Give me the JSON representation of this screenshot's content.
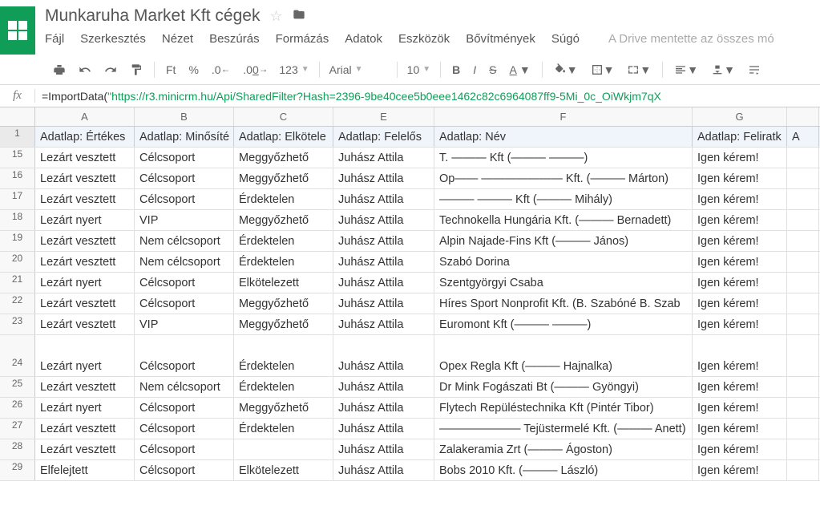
{
  "doc": {
    "title": "Munkaruha Market Kft cégek"
  },
  "menu": {
    "file": "Fájl",
    "edit": "Szerkesztés",
    "view": "Nézet",
    "insert": "Beszúrás",
    "format": "Formázás",
    "data": "Adatok",
    "tools": "Eszközök",
    "addons": "Bővítmények",
    "help": "Súgó",
    "drive_status": "A Drive mentette az összes mó"
  },
  "toolbar": {
    "currency": "Ft",
    "percent": "%",
    "dec_dec": ".0",
    "inc_dec": ".00",
    "num_format": "123",
    "font": "Arial",
    "size": "10"
  },
  "formula": {
    "prefix": "=ImportData(",
    "str": "\"https://r3.minicrm.hu/Api/SharedFilter?Hash=2396-9be40cee5b0eee1462c82c6964087ff9-5Mi_0c_OiWkjm7qX",
    "suffix": ""
  },
  "cols": {
    "A": "A",
    "B": "B",
    "C": "C",
    "D": "E",
    "E": "F",
    "G": "G"
  },
  "header": {
    "A": "Adatlap: Értékes",
    "B": "Adatlap: Minősíté",
    "C": "Adatlap: Elkötele",
    "D": "Adatlap: Felelős",
    "E": "Adatlap: Név",
    "G": "Adatlap: Feliratk",
    "H": "A"
  },
  "rows": [
    {
      "n": "15",
      "A": "Lezárt vesztett",
      "B": "Célcsoport",
      "C": "Meggyőzhető",
      "D": "Juhász Attila",
      "E": "T. ——— Kft (——— ———)",
      "G": "Igen kérem!"
    },
    {
      "n": "16",
      "A": "Lezárt vesztett",
      "B": "Célcsoport",
      "C": "Meggyőzhető",
      "D": "Juhász Attila",
      "E": "Op—— ——————— Kft. (——— Márton)",
      "G": "Igen kérem!"
    },
    {
      "n": "17",
      "A": "Lezárt vesztett",
      "B": "Célcsoport",
      "C": "Érdektelen",
      "D": "Juhász Attila",
      "E": "——— ——— Kft (——— Mihály)",
      "G": "Igen kérem!"
    },
    {
      "n": "18",
      "A": "Lezárt nyert",
      "B": "VIP",
      "C": "Meggyőzhető",
      "D": "Juhász Attila",
      "E": "Technokella Hungária Kft. (——— Bernadett)",
      "G": "Igen kérem!"
    },
    {
      "n": "19",
      "A": "Lezárt vesztett",
      "B": "Nem célcsoport",
      "C": "Érdektelen",
      "D": "Juhász Attila",
      "E": "Alpin Najade-Fins Kft (——— János)",
      "G": "Igen kérem!"
    },
    {
      "n": "20",
      "A": "Lezárt vesztett",
      "B": "Nem célcsoport",
      "C": "Érdektelen",
      "D": "Juhász Attila",
      "E": "Szabó Dorina",
      "G": "Igen kérem!"
    },
    {
      "n": "21",
      "A": "Lezárt nyert",
      "B": "Célcsoport",
      "C": "Elkötelezett",
      "D": "Juhász Attila",
      "E": "Szentgyörgyi Csaba",
      "G": "Igen kérem!"
    },
    {
      "n": "22",
      "A": "Lezárt vesztett",
      "B": "Célcsoport",
      "C": "Meggyőzhető",
      "D": "Juhász Attila",
      "E": "Híres Sport Nonprofit Kft. (B. Szabóné B. Szab",
      "G": "Igen kérem!"
    },
    {
      "n": "23",
      "A": "Lezárt vesztett",
      "B": "VIP",
      "C": "Meggyőzhető",
      "D": "Juhász Attila",
      "E": "Euromont Kft (——— ———)",
      "G": "Igen kérem!"
    },
    {
      "n": "24",
      "A": "Lezárt nyert",
      "B": "Célcsoport",
      "C": "Érdektelen",
      "D": "Juhász Attila",
      "E": "Opex Regla Kft (——— Hajnalka)",
      "G": "Igen kérem!",
      "tall": true
    },
    {
      "n": "25",
      "A": "Lezárt vesztett",
      "B": "Nem célcsoport",
      "C": "Érdektelen",
      "D": "Juhász Attila",
      "E": "Dr Mink Fogászati Bt (——— Gyöngyi)",
      "G": "Igen kérem!"
    },
    {
      "n": "26",
      "A": "Lezárt nyert",
      "B": "Célcsoport",
      "C": "Meggyőzhető",
      "D": "Juhász Attila",
      "E": "Flytech Repüléstechnika Kft (Pintér Tibor)",
      "G": "Igen kérem!"
    },
    {
      "n": "27",
      "A": "Lezárt vesztett",
      "B": "Célcsoport",
      "C": "Érdektelen",
      "D": "Juhász Attila",
      "E": "——————— Tejüstermelé Kft. (——— Anett)",
      "G": "Igen kérem!"
    },
    {
      "n": "28",
      "A": "Lezárt vesztett",
      "B": "Célcsoport",
      "C": "",
      "D": "Juhász Attila",
      "E": "Zalakeramia Zrt (——— Ágoston)",
      "G": "Igen kérem!"
    },
    {
      "n": "29",
      "A": "Elfelejtett",
      "B": "Célcsoport",
      "C": "Elkötelezett",
      "D": "Juhász Attila",
      "E": "Bobs 2010 Kft. (——— László)",
      "G": "Igen kérem!"
    }
  ]
}
